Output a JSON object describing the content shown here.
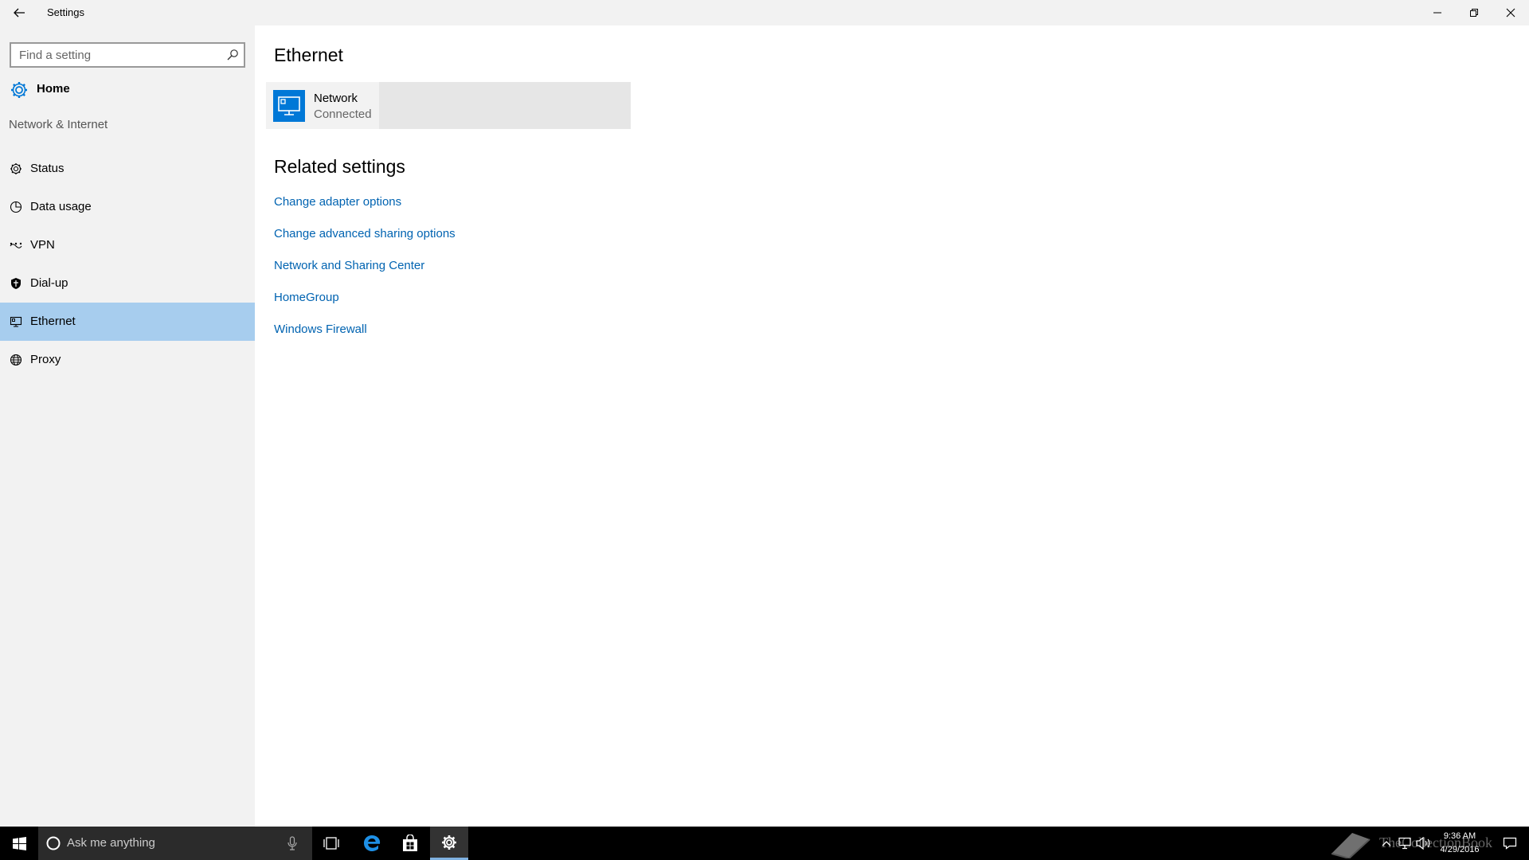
{
  "window": {
    "title": "Settings"
  },
  "sidebar": {
    "search_placeholder": "Find a setting",
    "home_label": "Home",
    "section_label": "Network & Internet",
    "items": [
      {
        "label": "Status",
        "icon": "status-gear-icon",
        "active": false
      },
      {
        "label": "Data usage",
        "icon": "data-usage-icon",
        "active": false
      },
      {
        "label": "VPN",
        "icon": "vpn-icon",
        "active": false
      },
      {
        "label": "Dial-up",
        "icon": "dial-up-icon",
        "active": false
      },
      {
        "label": "Ethernet",
        "icon": "ethernet-icon",
        "active": true
      },
      {
        "label": "Proxy",
        "icon": "globe-icon",
        "active": false
      }
    ]
  },
  "main": {
    "page_title": "Ethernet",
    "network_tile": {
      "name": "Network",
      "status": "Connected"
    },
    "related_title": "Related settings",
    "related_links": [
      "Change adapter options",
      "Change advanced sharing options",
      "Network and Sharing Center",
      "HomeGroup",
      "Windows Firewall"
    ]
  },
  "taskbar": {
    "search_placeholder": "Ask me anything",
    "time": "9:36 AM",
    "date": "4/29/2016",
    "watermark": "TheCollectionBook"
  },
  "colors": {
    "accent": "#0078d7",
    "link": "#0063b1",
    "active_nav": "#a7cdee",
    "sidebar_bg": "#f2f2f2",
    "taskbar_bg": "#000000"
  }
}
